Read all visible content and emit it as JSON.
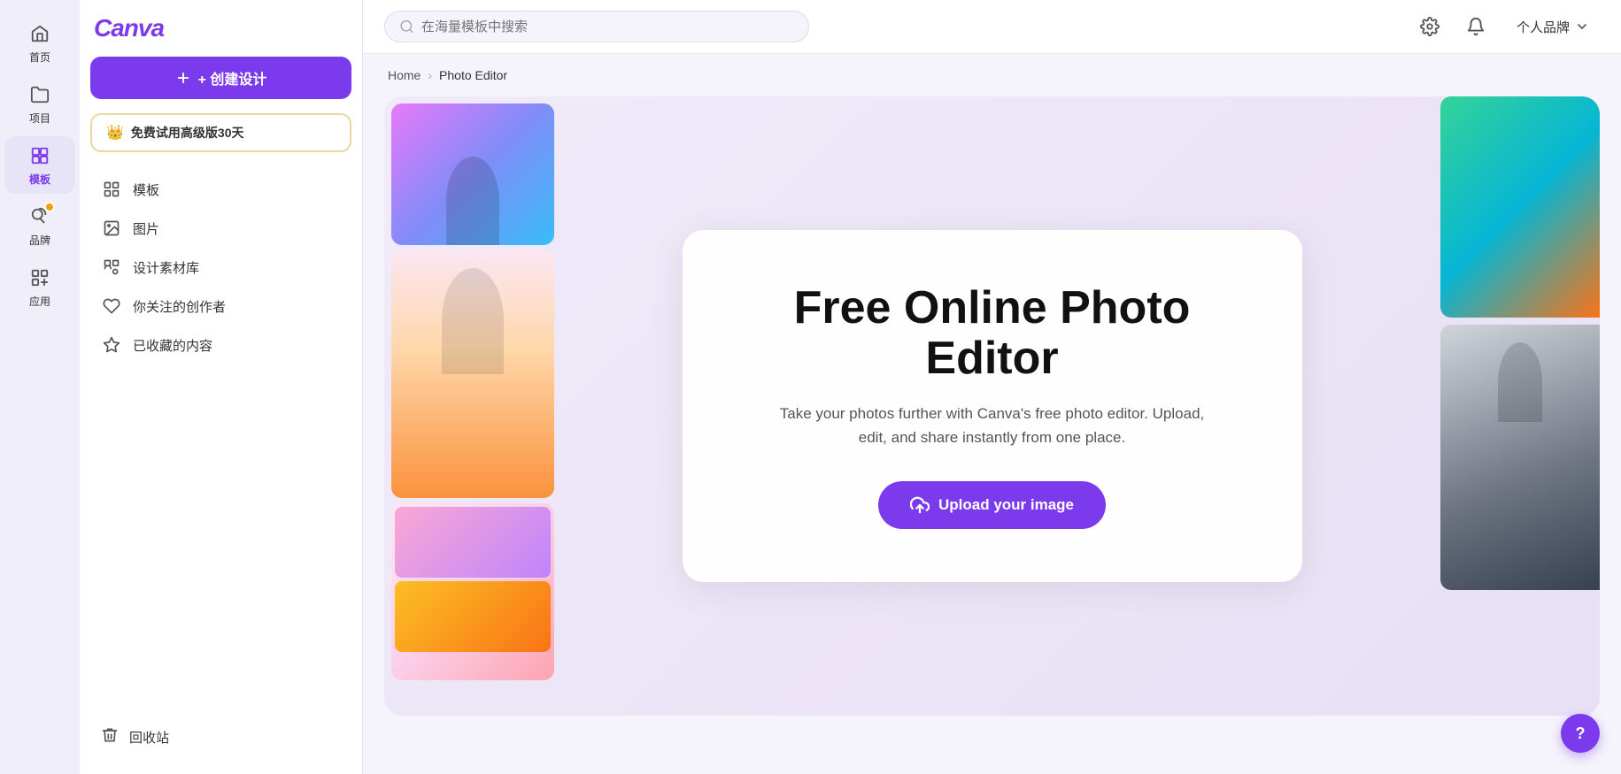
{
  "sidebar": {
    "items": [
      {
        "id": "home",
        "label": "首页",
        "icon": "🏠",
        "active": false
      },
      {
        "id": "projects",
        "label": "项目",
        "icon": "📁",
        "active": false
      },
      {
        "id": "templates",
        "label": "模板",
        "icon": "⊞",
        "active": true
      },
      {
        "id": "brand",
        "label": "品牌",
        "icon": "🎨",
        "active": false
      },
      {
        "id": "apps",
        "label": "应用",
        "icon": "⊞+",
        "active": false
      }
    ]
  },
  "leftPanel": {
    "logo": "Canva",
    "createBtn": "+ 创建设计",
    "trialBtn": "免费试用高级版30天",
    "navItems": [
      {
        "id": "templates",
        "label": "模板",
        "icon": "▦"
      },
      {
        "id": "images",
        "label": "图片",
        "icon": "🖼"
      },
      {
        "id": "assets",
        "label": "设计素材库",
        "icon": "⊞♥"
      },
      {
        "id": "following",
        "label": "你关注的创作者",
        "icon": "♥"
      },
      {
        "id": "saved",
        "label": "已收藏的内容",
        "icon": "☆"
      }
    ],
    "trashLabel": "回收站"
  },
  "topbar": {
    "searchPlaceholder": "在海量模板中搜索",
    "brandLabel": "个人品牌"
  },
  "breadcrumb": {
    "home": "Home",
    "separator": ">",
    "current": "Photo Editor"
  },
  "hero": {
    "title": "Free Online Photo Editor",
    "subtitle": "Take your photos further with Canva's free photo editor. Upload, edit, and share instantly from one place.",
    "uploadBtn": "Upload your image"
  },
  "help": {
    "label": "?"
  }
}
